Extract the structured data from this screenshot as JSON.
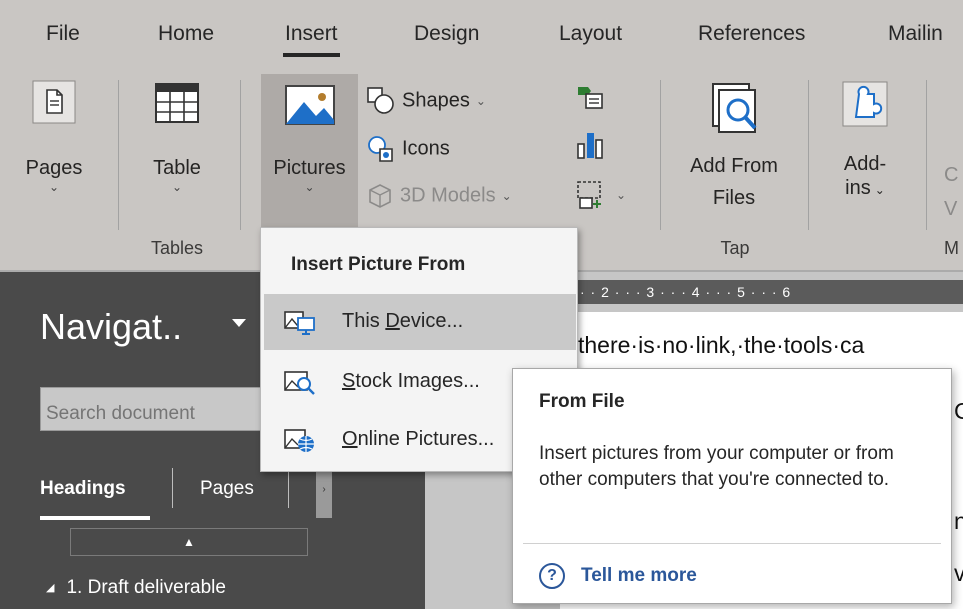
{
  "menu": {
    "tabs": [
      {
        "label": "File"
      },
      {
        "label": "Home"
      },
      {
        "label": "Insert",
        "active": true
      },
      {
        "label": "Design"
      },
      {
        "label": "Layout"
      },
      {
        "label": "References"
      },
      {
        "label": "Mailin"
      }
    ]
  },
  "ribbon": {
    "pages": {
      "label": "Pages"
    },
    "table": {
      "label": "Table",
      "group": "Tables"
    },
    "pictures": {
      "label": "Pictures"
    },
    "shapes": {
      "label": "Shapes"
    },
    "icons": {
      "label": "Icons"
    },
    "models3d": {
      "label": "3D Models"
    },
    "add_from_files": {
      "line1": "Add From",
      "line2": "Files",
      "group": "Tap"
    },
    "addins": {
      "line1": "Add-",
      "line2": "ins"
    },
    "cut_c": "C",
    "cut_v": "V",
    "cut_m": "M"
  },
  "picture_menu": {
    "title": "Insert Picture From",
    "items": [
      {
        "pre": "This ",
        "key": "D",
        "post": "evice...",
        "icon": "this-device-icon"
      },
      {
        "pre": "",
        "key": "S",
        "post": "tock Images...",
        "icon": "stock-images-icon"
      },
      {
        "pre": "",
        "key": "O",
        "post": "nline Pictures...",
        "icon": "online-pictures-icon"
      }
    ]
  },
  "tooltip": {
    "title": "From File",
    "body": "Insert pictures from your computer or from other computers that you're connected to.",
    "help": "Tell me more"
  },
  "nav": {
    "title": "Navigat..",
    "search_placeholder": "Search document",
    "tabs": [
      "Headings",
      "Pages"
    ],
    "heading": "1. Draft deliverable"
  },
  "document": {
    "ruler": "· · 2 · · · 3 · · · 4 · · · 5 · · · 6",
    "line1": "there·is·no·link,·the·tools·ca",
    "frag2": "C",
    "frag3": "n",
    "frag4": "v"
  },
  "colors": {
    "ribbon_bg": "#c9c6c3",
    "nav_bg": "#4a4a4a",
    "link_blue": "#2b579a",
    "accent_blue": "#1e6fc8"
  }
}
